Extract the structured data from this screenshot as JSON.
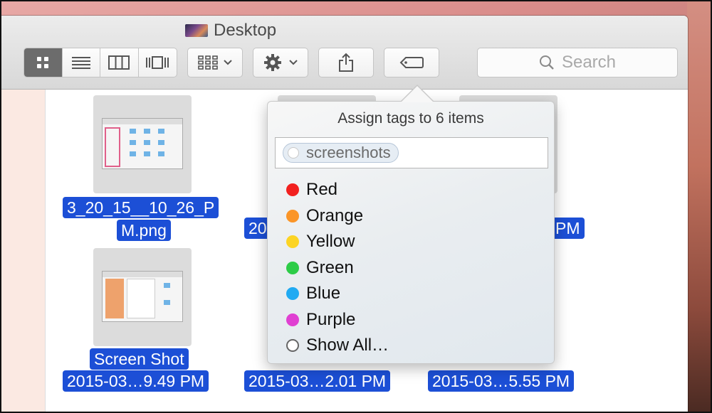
{
  "window": {
    "title": "Desktop"
  },
  "toolbar": {
    "views": [
      {
        "name": "icon-view-button",
        "icon": "grid-icon",
        "active": true
      },
      {
        "name": "list-view-button",
        "icon": "list-icon",
        "active": false
      },
      {
        "name": "column-view-button",
        "icon": "columns-icon",
        "active": false
      },
      {
        "name": "coverflow-view-button",
        "icon": "coverflow-icon",
        "active": false
      }
    ],
    "arrange_icon": "arrange-grid-icon",
    "action_icon": "gear-icon",
    "share_icon": "share-icon",
    "tag_icon": "tag-icon",
    "search_placeholder": "Search"
  },
  "files": [
    {
      "line1": "3_20_15__10_26_P",
      "line2": "M.png"
    },
    {
      "line1": "",
      "line2": "20"
    },
    {
      "line1": "",
      "line2": "PM"
    },
    {
      "line1": "Screen Shot",
      "line2": "2015-03…9.49 PM"
    },
    {
      "line1": "",
      "line2": "2015-03…2.01 PM"
    },
    {
      "line1": "",
      "line2": "2015-03…5.55 PM"
    }
  ],
  "popover": {
    "title": "Assign tags to 6 items",
    "token": "screenshots",
    "tags": [
      {
        "label": "Red",
        "color": "#f2201f"
      },
      {
        "label": "Orange",
        "color": "#fb9527"
      },
      {
        "label": "Yellow",
        "color": "#fcd424"
      },
      {
        "label": "Green",
        "color": "#2dcc47"
      },
      {
        "label": "Blue",
        "color": "#20aaf2"
      },
      {
        "label": "Purple",
        "color": "#e040d2"
      }
    ],
    "show_all": "Show All…"
  },
  "colors": {
    "selection": "#1c4fd6",
    "active_view": "#6c6c6c"
  }
}
